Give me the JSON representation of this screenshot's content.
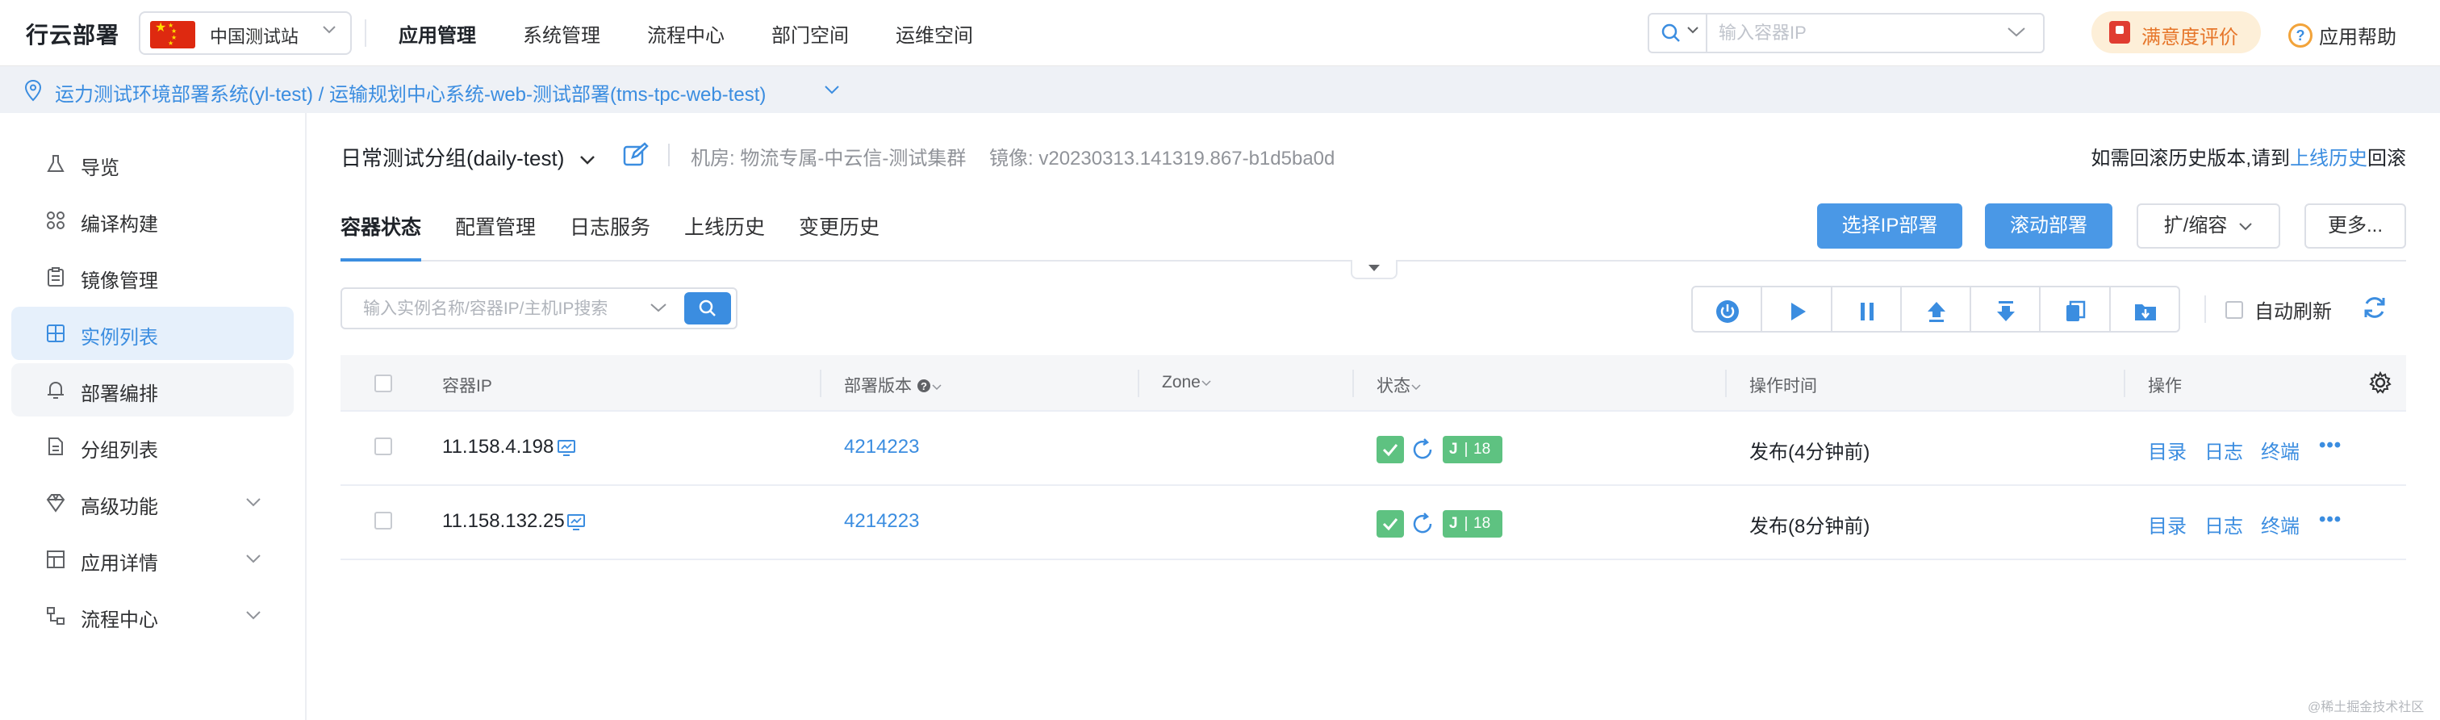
{
  "topnav": {
    "logo": "行云部署",
    "site": "中国测试站",
    "menu": [
      "应用管理",
      "系统管理",
      "流程中心",
      "部门空间",
      "运维空间"
    ],
    "search_placeholder": "输入容器IP",
    "satisfaction": "满意度评价",
    "help": "应用帮助"
  },
  "breadcrumb": "运力测试环境部署系统(yl-test) / 运输规划中心系统-web-测试部署(tms-tpc-web-test)",
  "sidebar": {
    "items": [
      {
        "label": "导览",
        "icon": "flask-icon"
      },
      {
        "label": "编译构建",
        "icon": "build-icon"
      },
      {
        "label": "镜像管理",
        "icon": "clipboard-icon"
      },
      {
        "label": "实例列表",
        "icon": "grid-icon"
      },
      {
        "label": "部署编排",
        "icon": "bell-icon"
      },
      {
        "label": "分组列表",
        "icon": "doc-icon"
      },
      {
        "label": "高级功能",
        "icon": "diamond-icon"
      },
      {
        "label": "应用详情",
        "icon": "layout-icon"
      },
      {
        "label": "流程中心",
        "icon": "flow-icon"
      }
    ]
  },
  "main": {
    "group": "日常测试分组(daily-test)",
    "room_label": "机房:",
    "room": "物流专属-中云信-测试集群",
    "image_label": "镜像:",
    "image": "v20230313.141319.867-b1d5ba0d",
    "rollback_prefix": "如需回滚历史版本,请到",
    "rollback_link": "上线历史",
    "rollback_suffix": "回滚",
    "tabs": [
      "容器状态",
      "配置管理",
      "日志服务",
      "上线历史",
      "变更历史"
    ],
    "buttons": {
      "select_ip": "选择IP部署",
      "rolling": "滚动部署",
      "scale": "扩/缩容",
      "more": "更多..."
    },
    "instance_search_placeholder": "输入实例名称/容器IP/主机IP搜索",
    "auto_refresh": "自动刷新"
  },
  "table": {
    "columns": [
      "容器IP",
      "部署版本",
      "Zone",
      "状态",
      "操作时间",
      "操作"
    ],
    "rows": [
      {
        "ip": "11.158.4.198",
        "version": "4214223",
        "j_label": "J",
        "j_num": "18",
        "time": "发布(4分钟前)"
      },
      {
        "ip": "11.158.132.25",
        "version": "4214223",
        "j_label": "J",
        "j_num": "18",
        "time": "发布(8分钟前)"
      }
    ],
    "ops": [
      "目录",
      "日志",
      "终端"
    ],
    "more": "•••"
  },
  "watermark": "@稀土掘金技术社区",
  "colors": {
    "accent": "#3b8de0",
    "success": "#5ec281",
    "warning": "#e6762a"
  }
}
